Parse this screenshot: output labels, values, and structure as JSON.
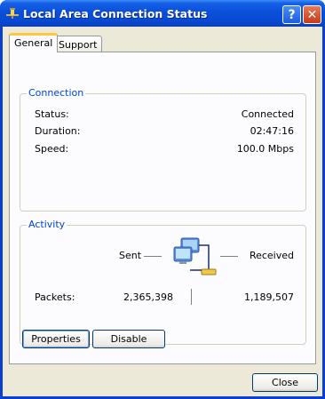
{
  "window": {
    "title": "Local Area Connection Status"
  },
  "titlebar": {
    "help_label": "?",
    "close_label": "✕"
  },
  "tabs": [
    {
      "label": "General",
      "selected": true
    },
    {
      "label": "Support",
      "selected": false
    }
  ],
  "connection": {
    "title": "Connection",
    "rows": [
      {
        "label": "Status:",
        "value": "Connected"
      },
      {
        "label": "Duration:",
        "value": "02:47:16"
      },
      {
        "label": "Speed:",
        "value": "100.0 Mbps"
      }
    ]
  },
  "activity": {
    "title": "Activity",
    "sent_label": "Sent",
    "received_label": "Received",
    "packets_label": "Packets:",
    "packets_sent": "2,365,398",
    "packets_received": "1,189,507"
  },
  "buttons": {
    "properties": "Properties",
    "disable": "Disable",
    "close": "Close"
  },
  "colors": {
    "titlebar": "#0a4fd9",
    "group_title": "#0046d5",
    "dialog_bg": "#ece9d8",
    "tab_accent": "#ffc83c"
  }
}
